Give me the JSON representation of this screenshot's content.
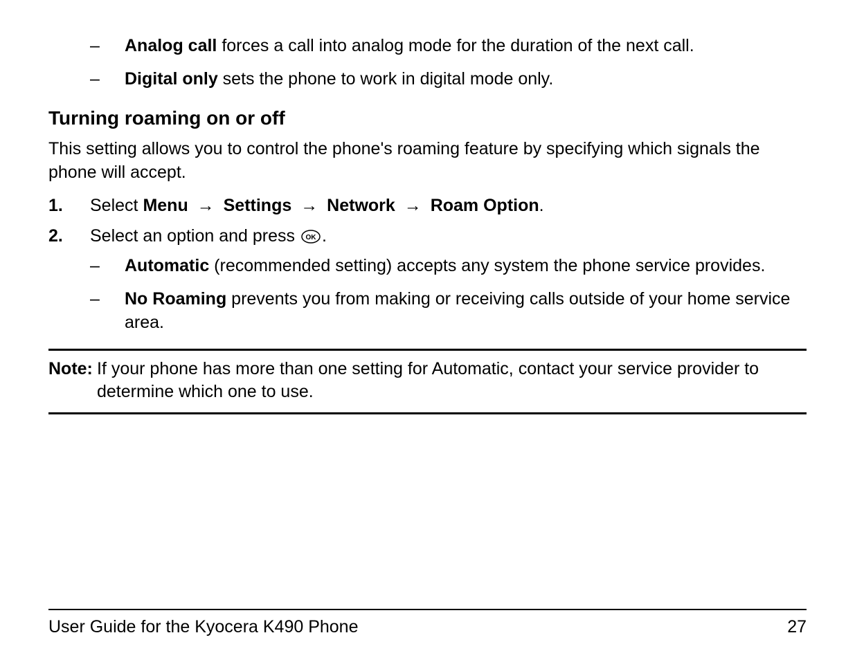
{
  "top_bullets": [
    {
      "bold": "Analog call",
      "rest": " forces a call into analog mode for the duration of the next call."
    },
    {
      "bold": "Digital only",
      "rest": " sets the phone to work in digital mode only."
    }
  ],
  "heading": "Turning roaming on or off",
  "intro": "This setting allows you to control the phone's roaming feature by specifying which signals the phone will accept.",
  "step1": {
    "num": "1.",
    "prefix": "Select ",
    "path": [
      "Menu",
      "Settings",
      "Network",
      "Roam Option"
    ],
    "suffix": "."
  },
  "step2": {
    "num": "2.",
    "text_before": "Select an option and press ",
    "text_after": "."
  },
  "sub_bullets": [
    {
      "bold": "Automatic",
      "rest": " (recommended setting) accepts any system the phone service provides."
    },
    {
      "bold": "No Roaming",
      "rest": " prevents you from making or receiving calls outside of your home service area."
    }
  ],
  "note": {
    "label": "Note:",
    "text": "If your phone has more than one setting for Automatic, contact your service provider to determine which one to use."
  },
  "footer": {
    "left": "User Guide for the Kyocera K490 Phone",
    "right": "27"
  }
}
